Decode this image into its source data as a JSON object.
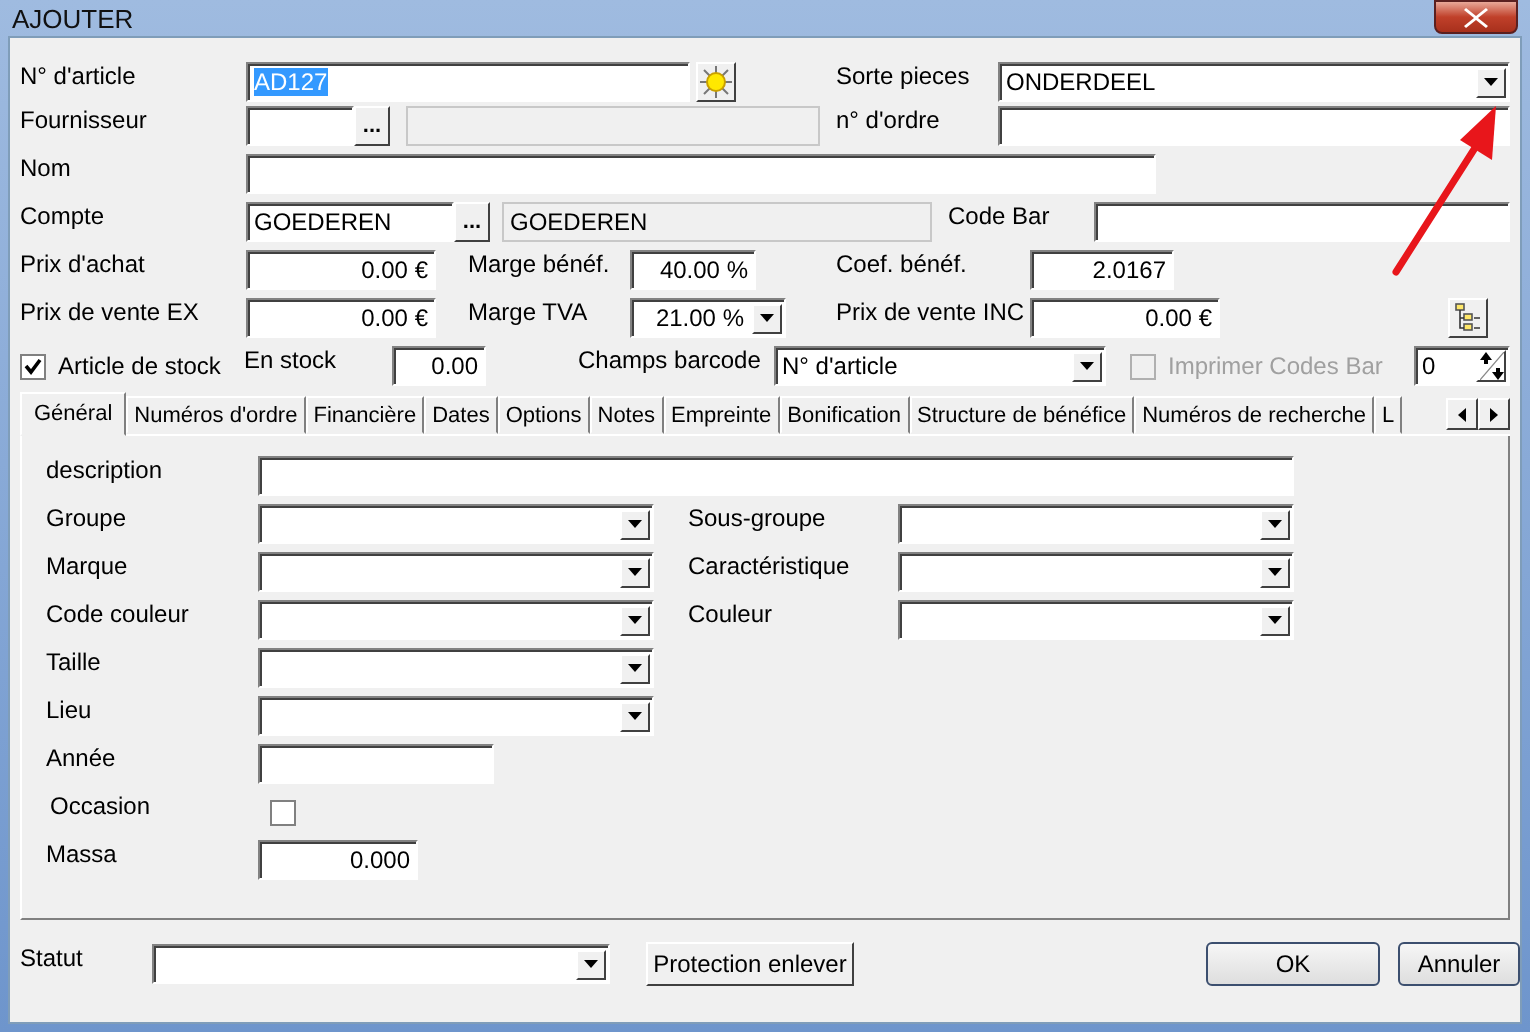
{
  "window": {
    "title": "AJOUTER"
  },
  "article_number": {
    "label": "N° d'article",
    "value": "AD127",
    "selected": true
  },
  "part_type": {
    "label": "Sorte pieces",
    "value": "ONDERDEEL"
  },
  "supplier": {
    "label": "Fournisseur",
    "button": "..."
  },
  "order_number": {
    "label": "n° d'ordre"
  },
  "name": {
    "label": "Nom"
  },
  "account": {
    "label": "Compte",
    "value": "GOEDEREN",
    "button": "...",
    "description": "GOEDEREN"
  },
  "barcode": {
    "label": "Code Bar"
  },
  "purchase_price": {
    "label": "Prix d'achat",
    "value": "0.00 €"
  },
  "profit_margin": {
    "label": "Marge bénéf.",
    "value": "40.00 %"
  },
  "profit_coef": {
    "label": "Coef. bénéf.",
    "value": "2.0167"
  },
  "sale_price_ex": {
    "label": "Prix de vente EX",
    "value": "0.00 €"
  },
  "vat_margin": {
    "label": "Marge TVA",
    "value": "21.00 %"
  },
  "sale_price_inc": {
    "label": "Prix de vente INC",
    "value": "0.00 €"
  },
  "stock_article": {
    "label": "Article de stock",
    "checked": true
  },
  "in_stock": {
    "label": "En stock",
    "value": "0.00"
  },
  "barcode_field": {
    "label": "Champs barcode",
    "value": "N° d'article"
  },
  "print_barcodes": {
    "label": "Imprimer Codes Bar",
    "checked": false,
    "disabled": true
  },
  "copies": {
    "value": "0"
  },
  "tabs": [
    {
      "label": "Général",
      "selected": true
    },
    {
      "label": "Numéros d'ordre",
      "selected": false
    },
    {
      "label": "Financière",
      "selected": false
    },
    {
      "label": "Dates",
      "selected": false
    },
    {
      "label": "Options",
      "selected": false
    },
    {
      "label": "Notes",
      "selected": false
    },
    {
      "label": "Empreinte",
      "selected": false
    },
    {
      "label": "Bonification",
      "selected": false
    },
    {
      "label": "Structure de bénéfice",
      "selected": false
    },
    {
      "label": "Numéros de recherche",
      "selected": false
    },
    {
      "label": "L",
      "selected": false
    }
  ],
  "general": {
    "description": {
      "label": "description"
    },
    "group": {
      "label": "Groupe"
    },
    "subgroup": {
      "label": "Sous-groupe"
    },
    "brand": {
      "label": "Marque"
    },
    "feature": {
      "label": "Caractéristique"
    },
    "color_code": {
      "label": "Code couleur"
    },
    "color": {
      "label": "Couleur"
    },
    "size": {
      "label": "Taille"
    },
    "place": {
      "label": "Lieu"
    },
    "year": {
      "label": "Année"
    },
    "used": {
      "label": "Occasion",
      "checked": false
    },
    "mass": {
      "label": "Massa",
      "value": "0.000"
    }
  },
  "status": {
    "label": "Statut"
  },
  "buttons": [
    "Protection enlever",
    "OK",
    "Annuler"
  ]
}
